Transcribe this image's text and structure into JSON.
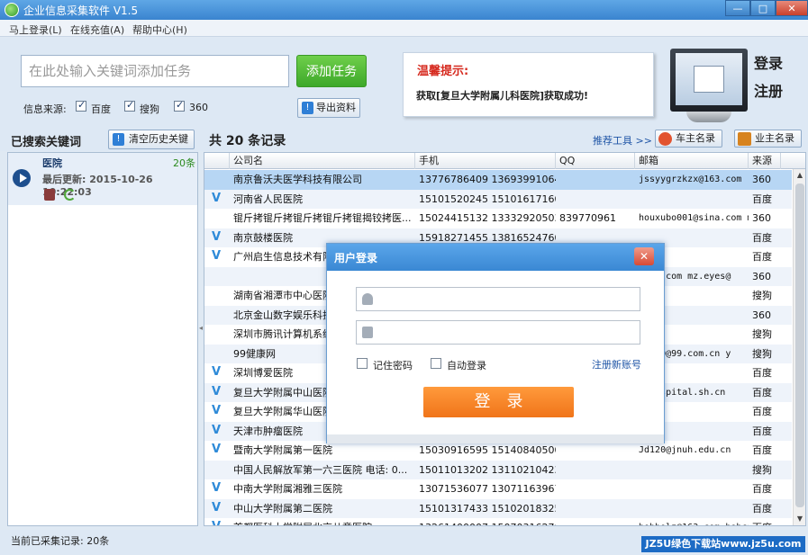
{
  "window": {
    "title": "企业信息采集软件 V1.5",
    "min": "—",
    "max": "□",
    "close": "✕"
  },
  "menu": [
    "马上登录(L)",
    "在线充值(A)",
    "帮助中心(H)"
  ],
  "task": {
    "placeholder": "在此处输入关键词添加任务",
    "add_label": "添加任务",
    "source_label": "信息来源:",
    "sources": [
      {
        "label": "百度",
        "checked": true
      },
      {
        "label": "搜狗",
        "checked": true
      },
      {
        "label": "360",
        "checked": true
      }
    ],
    "export_label": "导出资料"
  },
  "tip": {
    "title": "温馨提示:",
    "message": "获取[复旦大学附属儿科医院]获取成功!"
  },
  "account": {
    "login": "登录",
    "register": "注册"
  },
  "keywords_header": "已搜索关键词",
  "clear_history": "清空历史关键",
  "total_text": "共 20 条记录",
  "recommend_tools": "推荐工具 >>",
  "car_owners": "车主名录",
  "house_owners": "业主名录",
  "keyword_item": {
    "name": "医院",
    "count": "20条",
    "updated": "最后更新: 2015-10-26 10:22:03"
  },
  "table": {
    "columns": [
      "公司名",
      "手机",
      "QQ",
      "邮箱",
      "来源"
    ],
    "rows": [
      {
        "v": false,
        "name": "南京鲁沃夫医学科技有限公司",
        "phone": "13776786409  13693991064  ...",
        "qq": "",
        "email": "jssyygrzkzx@163.com",
        "source": "360"
      },
      {
        "v": true,
        "name": "河南省人民医院",
        "phone": "15101520245  15101617160  ...",
        "qq": "",
        "email": "",
        "source": "百度"
      },
      {
        "v": false,
        "name": "锟斤拷锟斤拷锟斤拷锟斤拷锟揭铰拷医...",
        "phone": "15024415132  13332920503",
        "qq": "839770961",
        "email": "houxubo001@sina.com mz",
        "source": "360"
      },
      {
        "v": true,
        "name": "南京鼓楼医院",
        "phone": "15918271455  13816524760  ...",
        "qq": "",
        "email": "",
        "source": "百度"
      },
      {
        "v": true,
        "name": "广州启生信息技术有限",
        "phone": "",
        "qq": "",
        "email": "",
        "source": "百度"
      },
      {
        "v": false,
        "name": "",
        "phone": "",
        "qq": "",
        "email": "@126.com mz.eyes@",
        "source": "360"
      },
      {
        "v": false,
        "name": "湖南省湘潭市中心医院",
        "phone": "",
        "qq": "",
        "email": "",
        "source": "搜狗"
      },
      {
        "v": false,
        "name": "北京金山数字娱乐科技",
        "phone": "",
        "qq": "",
        "email": "",
        "source": "360"
      },
      {
        "v": false,
        "name": "深圳市腾讯计算机系统",
        "phone": "",
        "qq": "",
        "email": "",
        "source": "搜狗"
      },
      {
        "v": false,
        "name": "99健康网",
        "phone": "",
        "qq": "",
        "email": "00120@99.com.cn y",
        "source": "搜狗"
      },
      {
        "v": true,
        "name": "深圳博爱医院",
        "phone": "",
        "qq": "",
        "email": "",
        "source": "百度"
      },
      {
        "v": true,
        "name": "复旦大学附属中山医院",
        "phone": "",
        "qq": "",
        "email": "s-hospital.sh.cn",
        "source": "百度"
      },
      {
        "v": true,
        "name": "复旦大学附属华山医院",
        "phone": "",
        "qq": "",
        "email": "",
        "source": "百度"
      },
      {
        "v": true,
        "name": "天津市肿瘤医院",
        "phone": "",
        "qq": "",
        "email": "",
        "source": "百度"
      },
      {
        "v": true,
        "name": "暨南大学附属第一医院",
        "phone": "15030916595  15140840500",
        "qq": "",
        "email": "Jd120@jnuh.edu.cn",
        "source": "百度"
      },
      {
        "v": false,
        "name": "中国人民解放军第一六三医院 电话: 0...",
        "phone": "15011013202  13110210423  ...",
        "qq": "",
        "email": "",
        "source": "搜狗"
      },
      {
        "v": true,
        "name": "中南大学附属湘雅三医院",
        "phone": "13071536077  13071163967  ...",
        "qq": "",
        "email": "",
        "source": "百度"
      },
      {
        "v": true,
        "name": "中山大学附属第二医院",
        "phone": "15101317433  15102018325  ...",
        "qq": "",
        "email": "",
        "source": "百度"
      },
      {
        "v": true,
        "name": "首都医科大学附属北京儿童医院",
        "phone": "13261400007  15070316270",
        "qq": "",
        "email": "bobbolz@163.com bobcan",
        "source": "百度"
      }
    ]
  },
  "status": "当前已采集记录: 20条",
  "watermark": "JZ5U绿色下载站www.jz5u.com",
  "login_dialog": {
    "title": "用户登录",
    "close": "✕",
    "remember": "记住密码",
    "auto_login": "自动登录",
    "register": "注册新账号",
    "login_button": "登录"
  }
}
